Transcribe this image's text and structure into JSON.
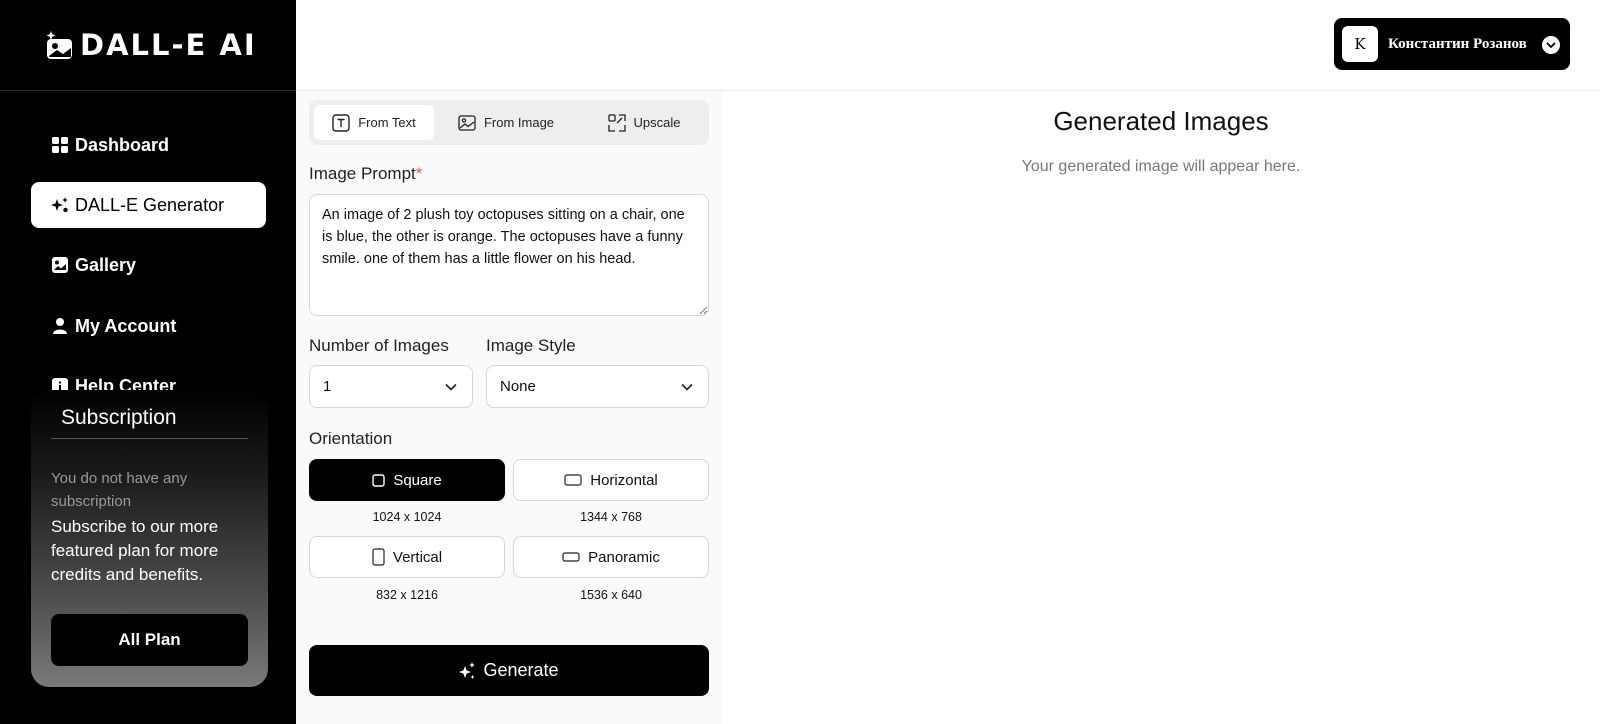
{
  "app": {
    "logo_text": "DALL-E AI"
  },
  "sidebar": {
    "items": [
      {
        "label": "Dashboard",
        "icon": "grid-icon"
      },
      {
        "label": "DALL-E Generator",
        "icon": "sparkle-icon",
        "active": true
      },
      {
        "label": "Gallery",
        "icon": "image-icon"
      },
      {
        "label": "My Account",
        "icon": "user-icon"
      },
      {
        "label": "Help Center",
        "icon": "info-icon"
      }
    ]
  },
  "subscription": {
    "title": "Subscription",
    "muted": "You do not have any subscription",
    "text": "Subscribe to our more featured plan for more credits and benefits.",
    "button": "All Plan"
  },
  "user": {
    "avatar_letter": "K",
    "name": "Константин Розанов"
  },
  "tabs": [
    {
      "label": "From Text",
      "icon": "text-icon",
      "active": true
    },
    {
      "label": "From Image",
      "icon": "image-icon"
    },
    {
      "label": "Upscale",
      "icon": "upscale-icon"
    }
  ],
  "form": {
    "prompt_label": "Image Prompt",
    "required_mark": "*",
    "prompt_value": "An image of 2 plush toy octopuses sitting on a chair, one is blue, the other is orange. The octopuses have a funny smile. one of them has a little flower on his head.",
    "num_images_label": "Number of Images",
    "num_images_value": "1",
    "style_label": "Image Style",
    "style_value": "None",
    "orientation_label": "Orientation",
    "orientations": [
      {
        "label": "Square",
        "dims": "1024 x 1024",
        "active": true
      },
      {
        "label": "Horizontal",
        "dims": "1344 x 768"
      },
      {
        "label": "Vertical",
        "dims": "832 x 1216"
      },
      {
        "label": "Panoramic",
        "dims": "1536 x 640"
      }
    ],
    "generate_label": "Generate"
  },
  "result": {
    "title": "Generated Images",
    "placeholder": "Your generated image will appear here."
  }
}
